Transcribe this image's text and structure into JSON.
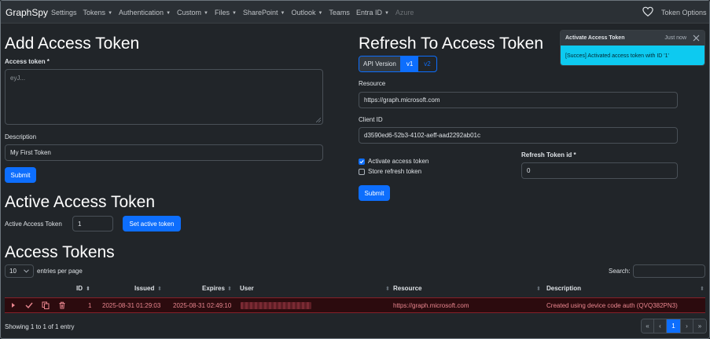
{
  "navbar": {
    "brand": "GraphSpy",
    "items": [
      {
        "label": "Settings",
        "dropdown": false
      },
      {
        "label": "Tokens",
        "dropdown": true
      },
      {
        "label": "Authentication",
        "dropdown": true
      },
      {
        "label": "Custom",
        "dropdown": true
      },
      {
        "label": "Files",
        "dropdown": true
      },
      {
        "label": "SharePoint",
        "dropdown": true
      },
      {
        "label": "Outlook",
        "dropdown": true
      },
      {
        "label": "Teams",
        "dropdown": false
      },
      {
        "label": "Entra ID",
        "dropdown": true
      },
      {
        "label": "Azure",
        "dropdown": false,
        "disabled": true
      }
    ],
    "token_options": "Token Options"
  },
  "add_token": {
    "title": "Add Access Token",
    "token_label": "Access token *",
    "token_placeholder": "eyJ...",
    "description_label": "Description",
    "description_value": "My First Token",
    "submit": "Submit"
  },
  "active_token": {
    "title": "Active Access Token",
    "label": "Active Access Token",
    "value": "1",
    "button": "Set active token"
  },
  "refresh": {
    "title": "Refresh To Access Token",
    "api_version_label": "API Version",
    "versions": [
      "v1",
      "v2"
    ],
    "selected_version": "v1",
    "resource_label": "Resource",
    "resource_value": "https://graph.microsoft.com",
    "client_id_label": "Client ID",
    "client_id_value": "d3590ed6-52b3-4102-aeff-aad2292ab01c",
    "activate_label": "Activate access token",
    "activate_checked": true,
    "store_label": "Store refresh token",
    "store_checked": false,
    "refresh_id_label": "Refresh Token id *",
    "refresh_id_value": "0",
    "submit": "Submit"
  },
  "toast": {
    "title": "Activate Access Token",
    "time": "Just now",
    "message": "[Succes] Activated access token with ID '1'"
  },
  "tokens": {
    "title": "Access Tokens",
    "page_length": "10",
    "entries_label": "entries per page",
    "search_label": "Search:",
    "columns": [
      "ID",
      "Issued",
      "Expires",
      "User",
      "Resource",
      "Description"
    ],
    "rows": [
      {
        "id": "1",
        "issued": "2025-08-31 01:29:03",
        "expires": "2025-08-31 02:49:10",
        "resource": "https://graph.microsoft.com",
        "description": "Created using device code auth (QVQ382PN3)"
      }
    ],
    "info": "Showing 1 to 1 of 1 entry",
    "pagination": [
      "«",
      "‹",
      "1",
      "›",
      "»"
    ],
    "current_page": "1"
  },
  "colors": {
    "primary": "#0d6efd",
    "info": "#0dcaf0",
    "danger_row_bg": "#2c0b0e",
    "danger_text": "#ea868f"
  }
}
